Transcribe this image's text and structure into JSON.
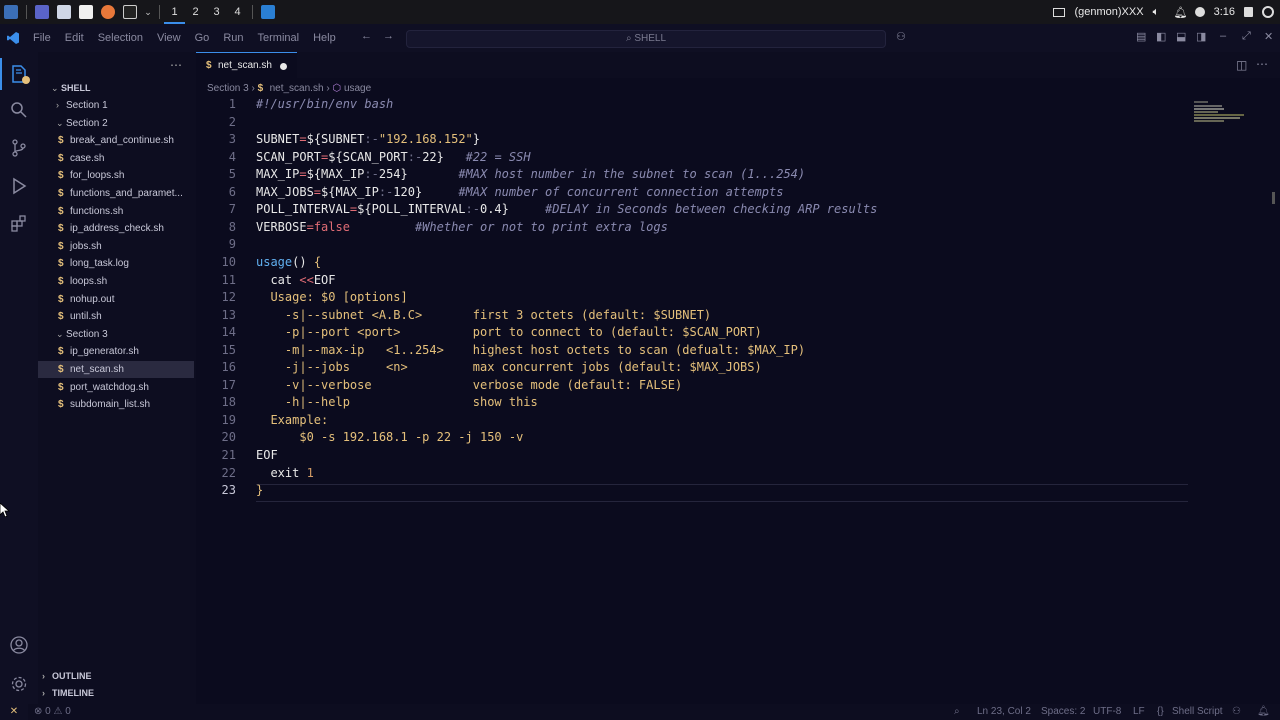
{
  "taskbar": {
    "workspaces": [
      "1",
      "2",
      "3",
      "4"
    ],
    "genmon_label": "(genmon)XXX",
    "clock": "3:16"
  },
  "titlebar": {
    "menu": [
      "File",
      "Edit",
      "Selection",
      "View",
      "Go",
      "Run",
      "Terminal",
      "Help"
    ],
    "search_text": "SHELL"
  },
  "sidebar": {
    "root": "SHELL",
    "rows": [
      {
        "label": "Section 1",
        "type": "folder",
        "chev": "›",
        "depth": 1
      },
      {
        "label": "Section 2",
        "type": "folder",
        "chev": "⌄",
        "depth": 1
      },
      {
        "label": "break_and_continue.sh",
        "type": "file",
        "depth": 2
      },
      {
        "label": "case.sh",
        "type": "file",
        "depth": 2
      },
      {
        "label": "for_loops.sh",
        "type": "file",
        "depth": 2
      },
      {
        "label": "functions_and_paramet...",
        "type": "file",
        "depth": 2
      },
      {
        "label": "functions.sh",
        "type": "file",
        "depth": 2
      },
      {
        "label": "ip_address_check.sh",
        "type": "file",
        "depth": 2
      },
      {
        "label": "jobs.sh",
        "type": "file",
        "depth": 2
      },
      {
        "label": "long_task.log",
        "type": "file",
        "depth": 2
      },
      {
        "label": "loops.sh",
        "type": "file",
        "depth": 2
      },
      {
        "label": "nohup.out",
        "type": "file",
        "depth": 2
      },
      {
        "label": "until.sh",
        "type": "file",
        "depth": 2
      },
      {
        "label": "Section 3",
        "type": "folder",
        "chev": "⌄",
        "depth": 1
      },
      {
        "label": "ip_generator.sh",
        "type": "file",
        "depth": 2
      },
      {
        "label": "net_scan.sh",
        "type": "file",
        "depth": 2,
        "selected": true
      },
      {
        "label": "port_watchdog.sh",
        "type": "file",
        "depth": 2
      },
      {
        "label": "subdomain_list.sh",
        "type": "file",
        "depth": 2
      }
    ],
    "outline": "OUTLINE",
    "timeline": "TIMELINE"
  },
  "editor": {
    "tab_label": "net_scan.sh",
    "breadcrumb": [
      "Section 3",
      "net_scan.sh",
      "usage"
    ],
    "current_line": 23,
    "lines": [
      [
        [
          "#!/usr/bin/env bash",
          "c-com"
        ]
      ],
      [],
      [
        [
          "SUBNET",
          "c-def"
        ],
        [
          "=",
          "c-op"
        ],
        [
          "${SUBNET",
          ""
        ],
        [
          ":-",
          "c-dim"
        ],
        [
          "\"192.168.152\"",
          "c-str"
        ],
        [
          "}",
          ""
        ]
      ],
      [
        [
          "SCAN_PORT",
          "c-def"
        ],
        [
          "=",
          "c-op"
        ],
        [
          "${SCAN_PORT",
          ""
        ],
        [
          ":-",
          "c-dim"
        ],
        [
          "22",
          ""
        ],
        [
          "}",
          ""
        ],
        [
          "   #22 = SSH",
          "c-com"
        ]
      ],
      [
        [
          "MAX_IP",
          "c-def"
        ],
        [
          "=",
          "c-op"
        ],
        [
          "${MAX_IP",
          ""
        ],
        [
          ":-",
          "c-dim"
        ],
        [
          "254",
          ""
        ],
        [
          "}",
          ""
        ],
        [
          "       #MAX host number in the subnet to scan (1...254)",
          "c-com"
        ]
      ],
      [
        [
          "MAX_JOBS",
          "c-def"
        ],
        [
          "=",
          "c-op"
        ],
        [
          "${MAX_IP",
          ""
        ],
        [
          ":-",
          "c-dim"
        ],
        [
          "120",
          ""
        ],
        [
          "}",
          ""
        ],
        [
          "     #MAX number of concurrent connection attempts",
          "c-com"
        ]
      ],
      [
        [
          "POLL_INTERVAL",
          "c-def"
        ],
        [
          "=",
          "c-op"
        ],
        [
          "${POLL_INTERVAL",
          ""
        ],
        [
          ":-",
          "c-dim"
        ],
        [
          "0.4",
          ""
        ],
        [
          "}",
          ""
        ],
        [
          "     #DELAY in Seconds between checking ARP results",
          "c-com"
        ]
      ],
      [
        [
          "VERBOSE",
          "c-def"
        ],
        [
          "=",
          "c-op"
        ],
        [
          "false",
          "c-kw"
        ],
        [
          "         #Whether or not to print extra logs",
          "c-com"
        ]
      ],
      [],
      [
        [
          "usage",
          "c-fn"
        ],
        [
          "() ",
          ""
        ],
        [
          "{",
          "c-yel"
        ]
      ],
      [
        [
          "  cat ",
          ""
        ],
        [
          "<<",
          "c-op"
        ],
        [
          "EOF",
          ""
        ]
      ],
      [
        [
          "  Usage: $0 [options]",
          "c-yel"
        ]
      ],
      [
        [
          "    -s|--subnet <A.B.C>       first 3 octets (default: $SUBNET)",
          "c-yel"
        ]
      ],
      [
        [
          "    -p|--port <port>          port to connect to (default: $SCAN_PORT)",
          "c-yel"
        ]
      ],
      [
        [
          "    -m|--max-ip   <1..254>    highest host octets to scan (defualt: $MAX_IP)",
          "c-yel"
        ]
      ],
      [
        [
          "    -j|--jobs     <n>         max concurrent jobs (default: $MAX_JOBS)",
          "c-yel"
        ]
      ],
      [
        [
          "    -v|--verbose              verbose mode (default: FALSE)",
          "c-yel"
        ]
      ],
      [
        [
          "    -h|--help                 show this",
          "c-yel"
        ]
      ],
      [
        [
          "  Example:",
          "c-yel"
        ]
      ],
      [
        [
          "      $0 -s 192.168.1 -p 22 -j 150 -v",
          "c-yel"
        ]
      ],
      [
        [
          "EOF",
          ""
        ]
      ],
      [
        [
          "  exit ",
          ""
        ],
        [
          "1",
          "c-num"
        ]
      ],
      [
        [
          "}",
          "c-yel"
        ]
      ]
    ]
  },
  "statusbar": {
    "errors": "0",
    "warnings": "0",
    "position": "Ln 23, Col 2",
    "spaces": "Spaces: 2",
    "encoding": "UTF-8",
    "eol": "LF",
    "language": "Shell Script"
  },
  "colors": {
    "accent": "#3b8eea",
    "background": "#0b0b1e",
    "shell_icon": "#e5c07b"
  }
}
